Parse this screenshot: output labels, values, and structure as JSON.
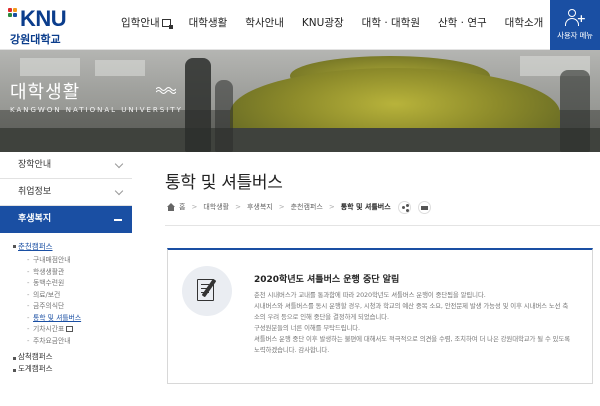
{
  "header": {
    "logo_text": "KNU",
    "logo_sub": "강원대학교",
    "gnb": [
      {
        "label": "입학안내",
        "external": true
      },
      {
        "label": "대학생활",
        "external": false
      },
      {
        "label": "학사안내",
        "external": false
      },
      {
        "label": "KNU광장",
        "external": false
      },
      {
        "label": "대학 · 대학원",
        "external": false
      },
      {
        "label": "산학 · 연구",
        "external": false
      },
      {
        "label": "대학소개",
        "external": false
      }
    ],
    "user_menu_label": "사용자 메뉴",
    "brand_color": "#1a4fa3"
  },
  "banner": {
    "title": "대학생활",
    "subtitle": "KANGWON NATIONAL UNIVERSITY"
  },
  "sidebar": {
    "items": [
      {
        "label": "장학안내"
      },
      {
        "label": "취업정보"
      },
      {
        "label": "후생복지"
      }
    ],
    "sub_head": "춘천캠퍼스",
    "sub_items": [
      "구내매점안내",
      "학생생활관",
      "동백수련원",
      "의료/보건",
      "금주의식단",
      "통학 및 셔틀버스",
      "기차시간표",
      "주차요금안내"
    ],
    "other_campuses": [
      "삼척캠퍼스",
      "도계캠퍼스"
    ]
  },
  "main": {
    "page_title": "통학 및 셔틀버스",
    "breadcrumb": [
      "홈",
      "대학생활",
      "후생복지",
      "춘천캠퍼스",
      "통학 및 셔틀버스"
    ]
  },
  "notice": {
    "title": "2020학년도 셔틀버스 운행 중단 알림",
    "lines": [
      "춘천 시내버스가 교내를 통과함에 따라 2020학년도 셔틀버스 운행이 중단됨을 알립니다.",
      "시내버스와 셔틀버스를 동시 운행할 경우, 시청과 학교의 예산 중복 소요, 안전문제 발생 가능성 및 이후 시내버스 노선 축",
      "소의 우려 등으로 인해 중단을 결정하게 되었습니다.",
      "구성원분들의 너른 이해를 부탁드립니다.",
      "셔틀버스 운행 중단 이후 발생하는 불편에 대해서도 적극적으로 의견을 수렴, 조치하여 더 나은 강원대학교가 될 수 있도록",
      "노력하겠습니다. 감사합니다."
    ]
  }
}
